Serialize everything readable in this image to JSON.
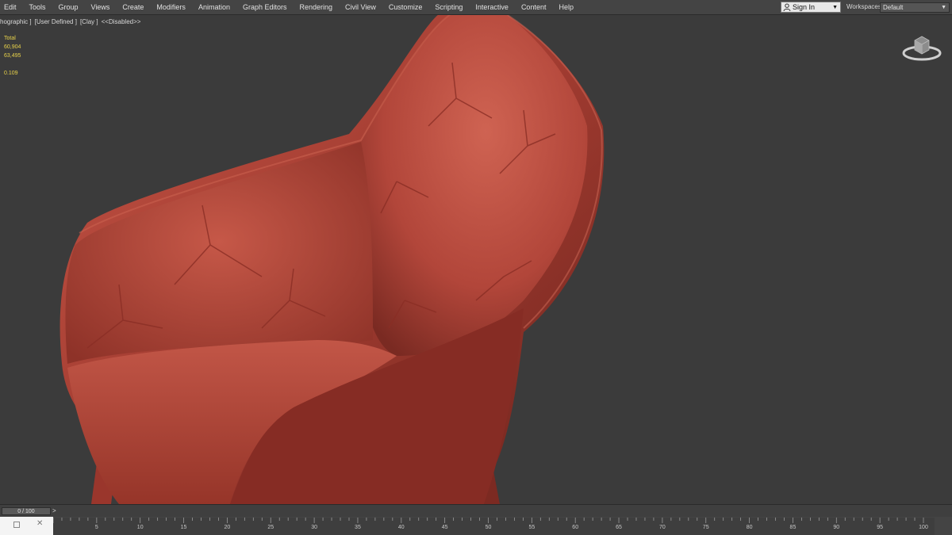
{
  "menu": [
    "Edit",
    "Tools",
    "Group",
    "Views",
    "Create",
    "Modifiers",
    "Animation",
    "Graph Editors",
    "Rendering",
    "Civil View",
    "Customize",
    "Scripting",
    "Interactive",
    "Content",
    "Help"
  ],
  "signin": {
    "label": "Sign In"
  },
  "workspaces": {
    "label": "Workspaces:",
    "value": "Default"
  },
  "viewport": {
    "labels": [
      "hographic ]",
      "[User Defined ]",
      "[Clay ]",
      "<<Disabled>>"
    ],
    "stats": [
      "Total",
      "60,904",
      "63,495",
      "",
      "0.109"
    ]
  },
  "timeline": {
    "frame_counter": "0 / 100",
    "ticks": [
      "5",
      "10",
      "15",
      "20",
      "25",
      "30",
      "35",
      "40",
      "45",
      "50",
      "55",
      "60",
      "65",
      "70",
      "75",
      "80",
      "85",
      "90",
      "95",
      "100"
    ]
  },
  "colors": {
    "stats": "#e8d24a",
    "chair": "#b3473b",
    "background": "#3b3b3b"
  }
}
